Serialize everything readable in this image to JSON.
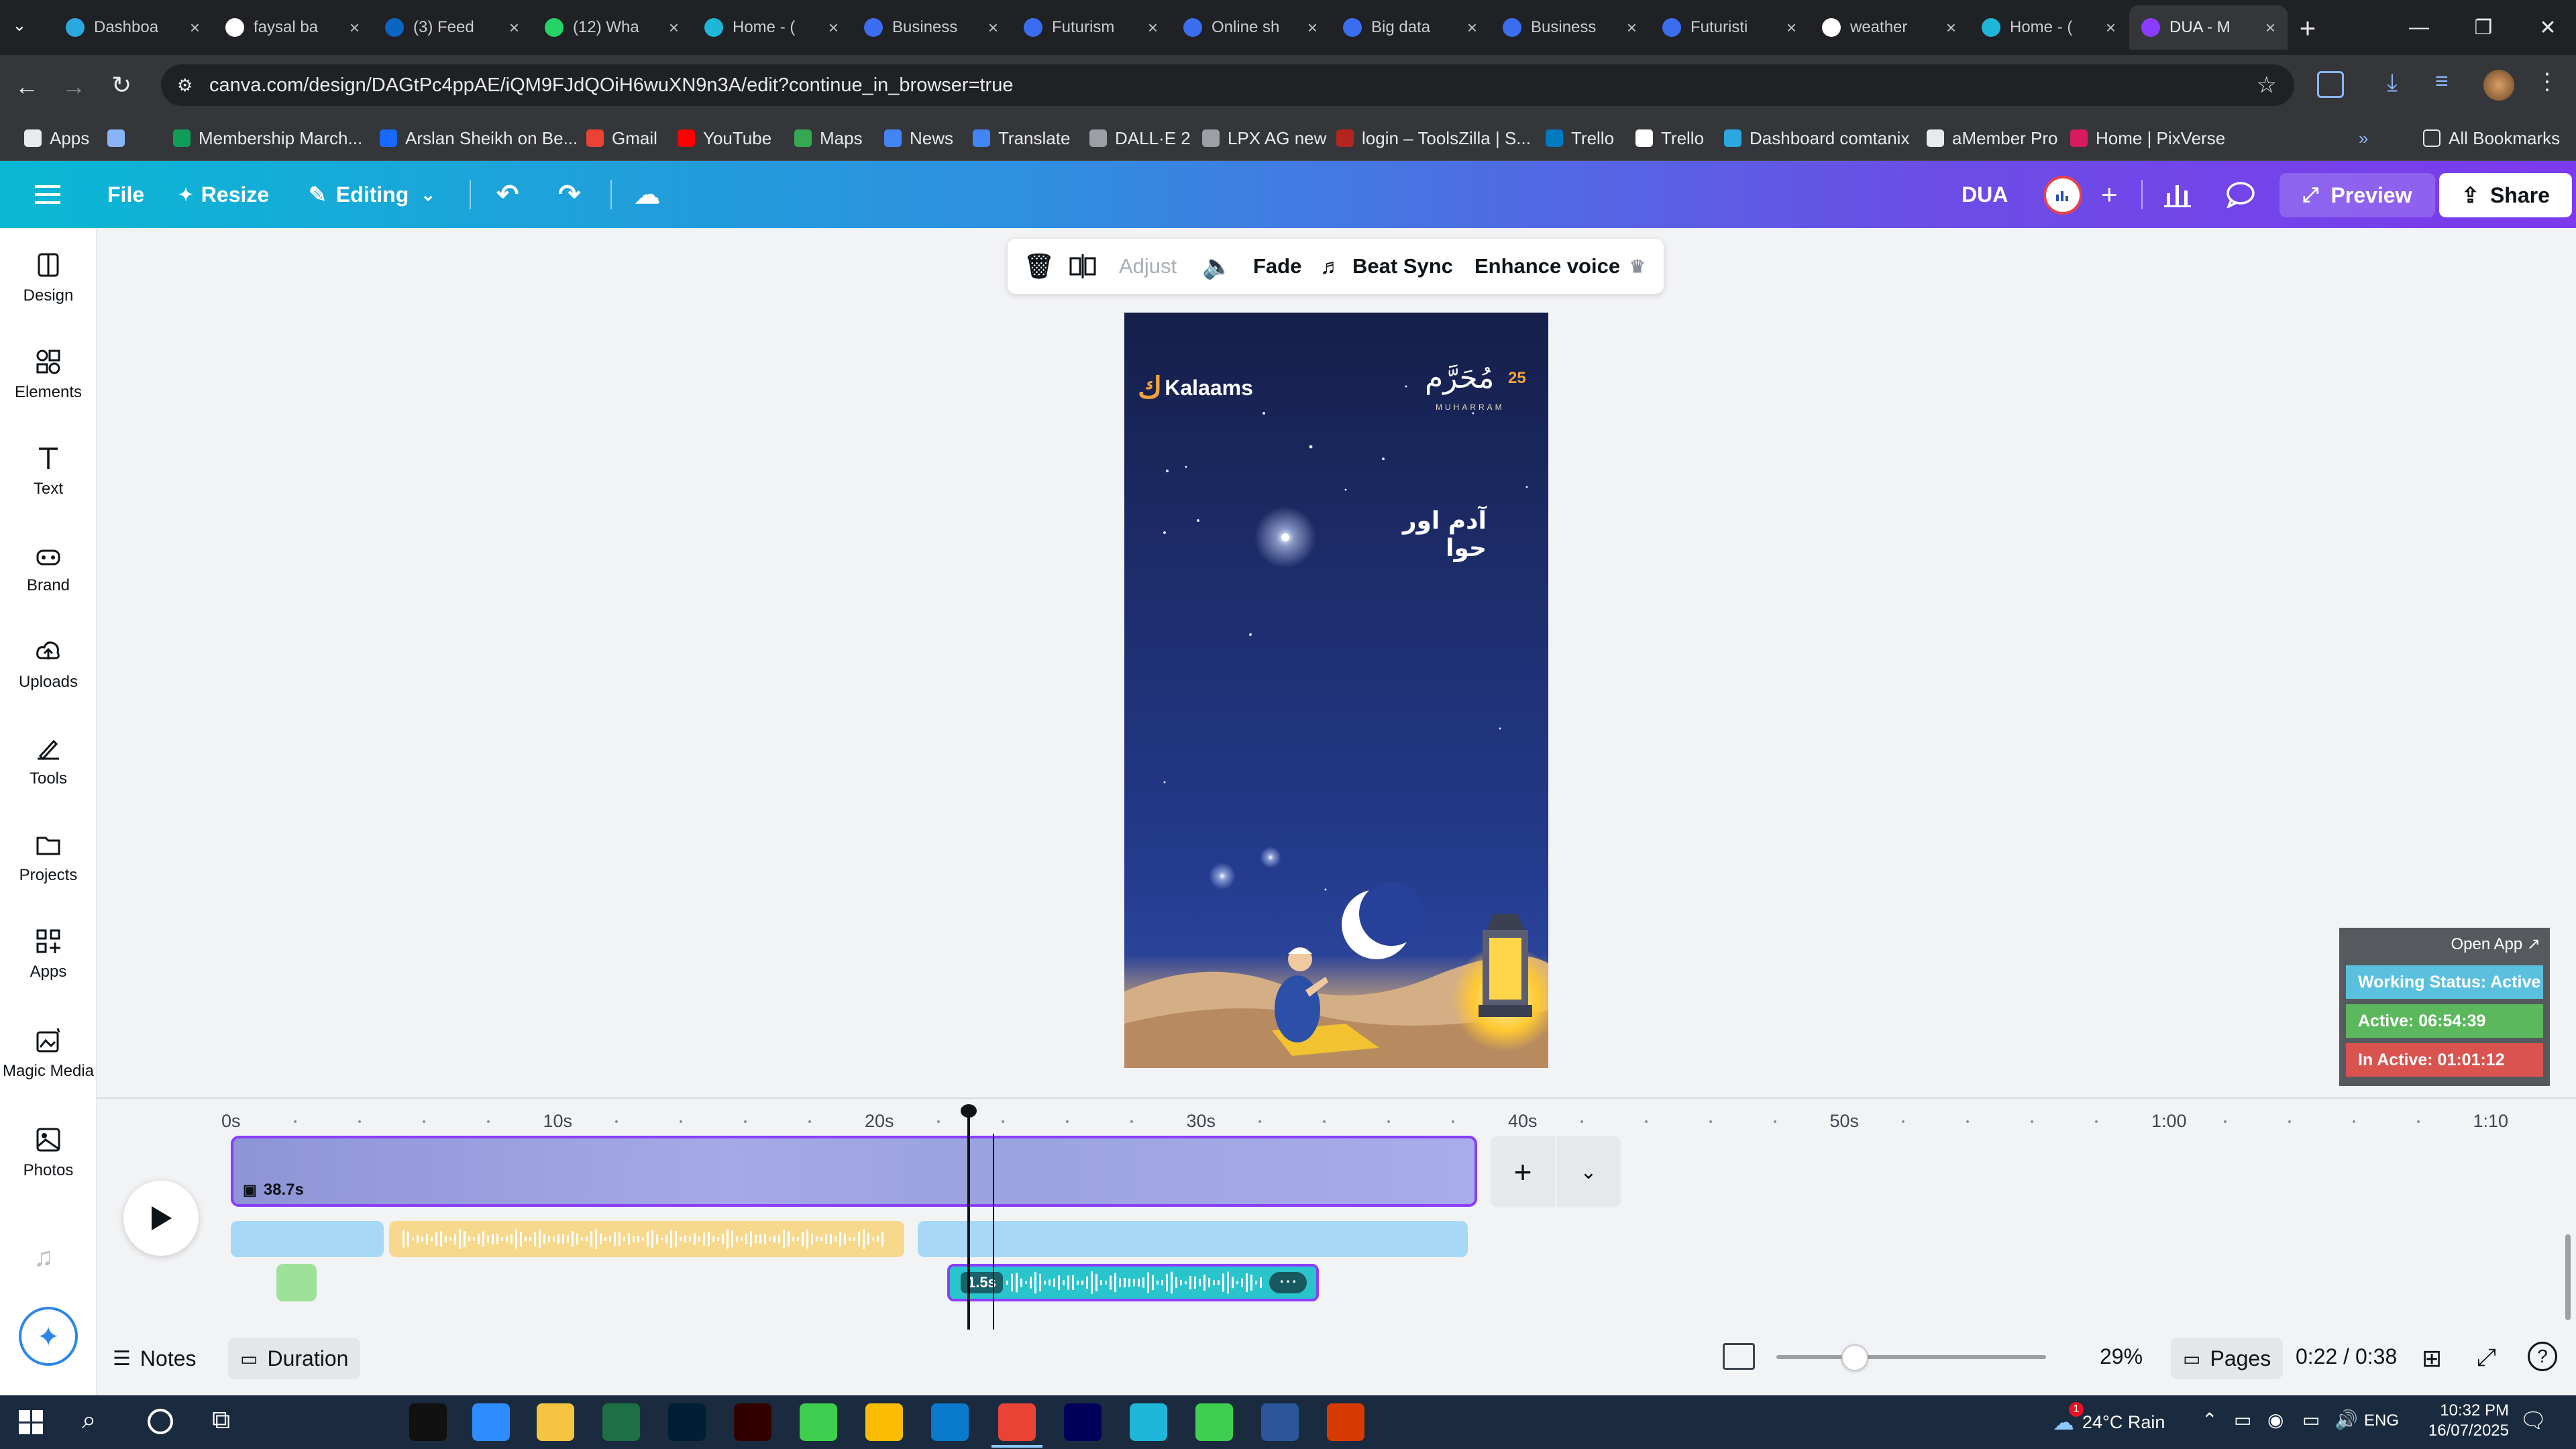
{
  "browser": {
    "tabs": [
      {
        "label": "Dashboa",
        "color": "#2ba8e0"
      },
      {
        "label": "faysal ba",
        "color": "#ffffff"
      },
      {
        "label": "(3) Feed",
        "color": "#0a66c2"
      },
      {
        "label": "(12) Wha",
        "color": "#25d366"
      },
      {
        "label": "Home - (",
        "color": "#1fb7d9"
      },
      {
        "label": "Business",
        "color": "#3b6df0"
      },
      {
        "label": "Futurism",
        "color": "#3b6df0"
      },
      {
        "label": "Online sh",
        "color": "#3b6df0"
      },
      {
        "label": "Big data",
        "color": "#3b6df0"
      },
      {
        "label": "Business",
        "color": "#3b6df0"
      },
      {
        "label": "Futuristi",
        "color": "#3b6df0"
      },
      {
        "label": "weather",
        "color": "#ffffff"
      },
      {
        "label": "Home - (",
        "color": "#1fb7d9"
      },
      {
        "label": "DUA - M",
        "color": "#8b3dff"
      }
    ],
    "url": "canva.com/design/DAGtPc4ppAE/iQM9FJdQOiH6wuXN9n3A/edit?continue_in_browser=true",
    "bookmarks": [
      {
        "label": "Apps",
        "color": "#e8eaed"
      },
      {
        "label": "",
        "color": "#8ab4f8"
      },
      {
        "label": "Membership March...",
        "color": "#0f9d58"
      },
      {
        "label": "Arslan Sheikh on Be...",
        "color": "#1769ff"
      },
      {
        "label": "Gmail",
        "color": "#ea4335"
      },
      {
        "label": "YouTube",
        "color": "#ff0000"
      },
      {
        "label": "Maps",
        "color": "#34a853"
      },
      {
        "label": "News",
        "color": "#4285f4"
      },
      {
        "label": "Translate",
        "color": "#4285f4"
      },
      {
        "label": "DALL·E 2",
        "color": "#9aa0a6"
      },
      {
        "label": "LPX AG new",
        "color": "#9aa0a6"
      },
      {
        "label": "login – ToolsZilla | S...",
        "color": "#b3261e"
      },
      {
        "label": "Trello",
        "color": "#0079bf"
      },
      {
        "label": "Trello",
        "color": "#ffffff"
      },
      {
        "label": "Dashboard comtanix",
        "color": "#2ba8e0"
      },
      {
        "label": "aMember Pro",
        "color": "#e8eaed"
      },
      {
        "label": "Home | PixVerse",
        "color": "#d81b60"
      }
    ],
    "all_bookmarks": "All Bookmarks"
  },
  "editor": {
    "file": "File",
    "resize": "Resize",
    "editing": "Editing",
    "design_name": "DUA",
    "preview": "Preview",
    "share": "Share"
  },
  "rail": [
    {
      "label": "Design",
      "icon": "design-icon"
    },
    {
      "label": "Elements",
      "icon": "elements-icon"
    },
    {
      "label": "Text",
      "icon": "text-icon"
    },
    {
      "label": "Brand",
      "icon": "brand-icon"
    },
    {
      "label": "Uploads",
      "icon": "uploads-icon"
    },
    {
      "label": "Tools",
      "icon": "tools-icon"
    },
    {
      "label": "Projects",
      "icon": "projects-icon"
    },
    {
      "label": "Apps",
      "icon": "apps-icon"
    },
    {
      "label": "Magic Media",
      "icon": "magic-media-icon"
    },
    {
      "label": "Photos",
      "icon": "photos-icon"
    }
  ],
  "context_toolbar": {
    "adjust": "Adjust",
    "fade": "Fade",
    "beat_sync": "Beat Sync",
    "enhance_voice": "Enhance voice"
  },
  "canvas": {
    "brand": "Kalaams",
    "date_number": "25",
    "arabic_month": "مُحَرَّم",
    "month_latin": "MUHARRAM",
    "urdu_title": "آدم اور حوا"
  },
  "extension": {
    "open_app": "Open App ↗",
    "status": "Working Status: Active",
    "active": "Active: 06:54:39",
    "inactive": "In Active: 01:01:12",
    "colors": {
      "status": "#5bc0de",
      "active": "#5cb85c",
      "inactive": "#d9534f"
    }
  },
  "timeline": {
    "ticks": [
      "0s",
      "10s",
      "20s",
      "30s",
      "40s",
      "50s",
      "1:00",
      "1:10"
    ],
    "video_duration": "38.7s",
    "audio_clip_duration": "1.5s"
  },
  "bottom": {
    "notes": "Notes",
    "duration": "Duration",
    "zoom": "29%",
    "zoom_level": 0.29,
    "pages": "Pages",
    "time": "0:22 / 0:38"
  },
  "taskbar": {
    "weather": "24°C  Rain",
    "language": "ENG",
    "clock_time": "10:32 PM",
    "clock_date": "16/07/2025",
    "notification_count": "1"
  }
}
